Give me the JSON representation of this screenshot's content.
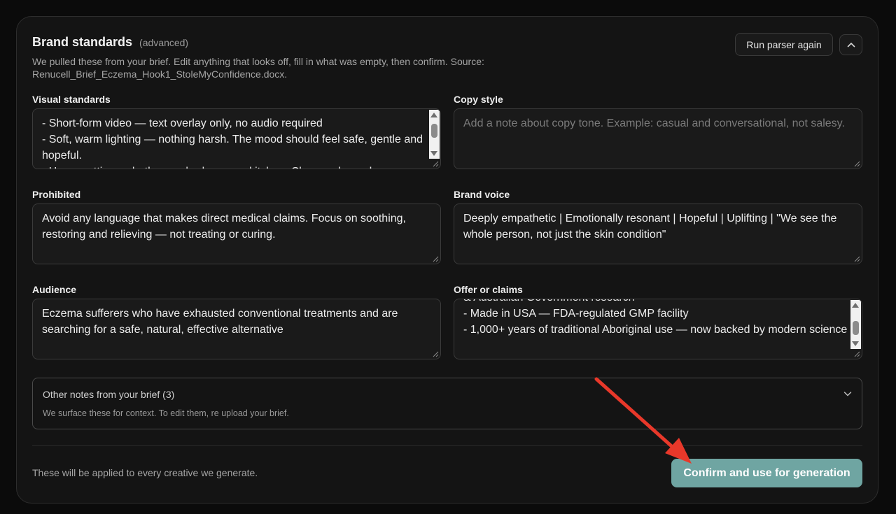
{
  "header": {
    "title": "Brand standards",
    "subtitle": "(advanced)",
    "description": "We pulled these from your brief. Edit anything that looks off, fill in what was empty, then confirm. Source: Renucell_Brief_Eczema_Hook1_StoleMyConfidence.docx.",
    "rerun_label": "Run parser again"
  },
  "fields": {
    "visual": {
      "label": "Visual standards",
      "value": "- Short-form video — text overlay only, no audio required\n- Soft, warm lighting — nothing harsh. The mood should feel safe, gentle and hopeful.\n- Home setting — bathroom, bedroom, or kitchen. Clean, calm and"
    },
    "copy_style": {
      "label": "Copy style",
      "placeholder": "Add a note about copy tone. Example: casual and conversational, not salesy."
    },
    "prohibited": {
      "label": "Prohibited",
      "value": "Avoid any language that makes direct medical claims. Focus on soothing, restoring and relieving — not treating or curing."
    },
    "brand_voice": {
      "label": "Brand voice",
      "value": "Deeply empathetic | Emotionally resonant | Hopeful | Uplifting | \"We see the whole person, not just the skin condition\""
    },
    "audience": {
      "label": "Audience",
      "value": "Eczema sufferers who have exhausted conventional treatments and are searching for a safe, natural, effective alternative"
    },
    "offer": {
      "label": "Offer or claims",
      "value": "& Australian Government research\n- Made in USA — FDA-regulated GMP facility\n- 1,000+ years of traditional Aboriginal use — now backed by modern science"
    }
  },
  "notes": {
    "title": "Other notes from your brief (3)",
    "subtitle": "We surface these for context. To edit them, re upload your brief."
  },
  "footer": {
    "text": "These will be applied to every creative we generate.",
    "confirm_label": "Confirm and use for generation"
  },
  "colors": {
    "accent": "#6fa5a2",
    "annotation_arrow": "#e8382a"
  }
}
